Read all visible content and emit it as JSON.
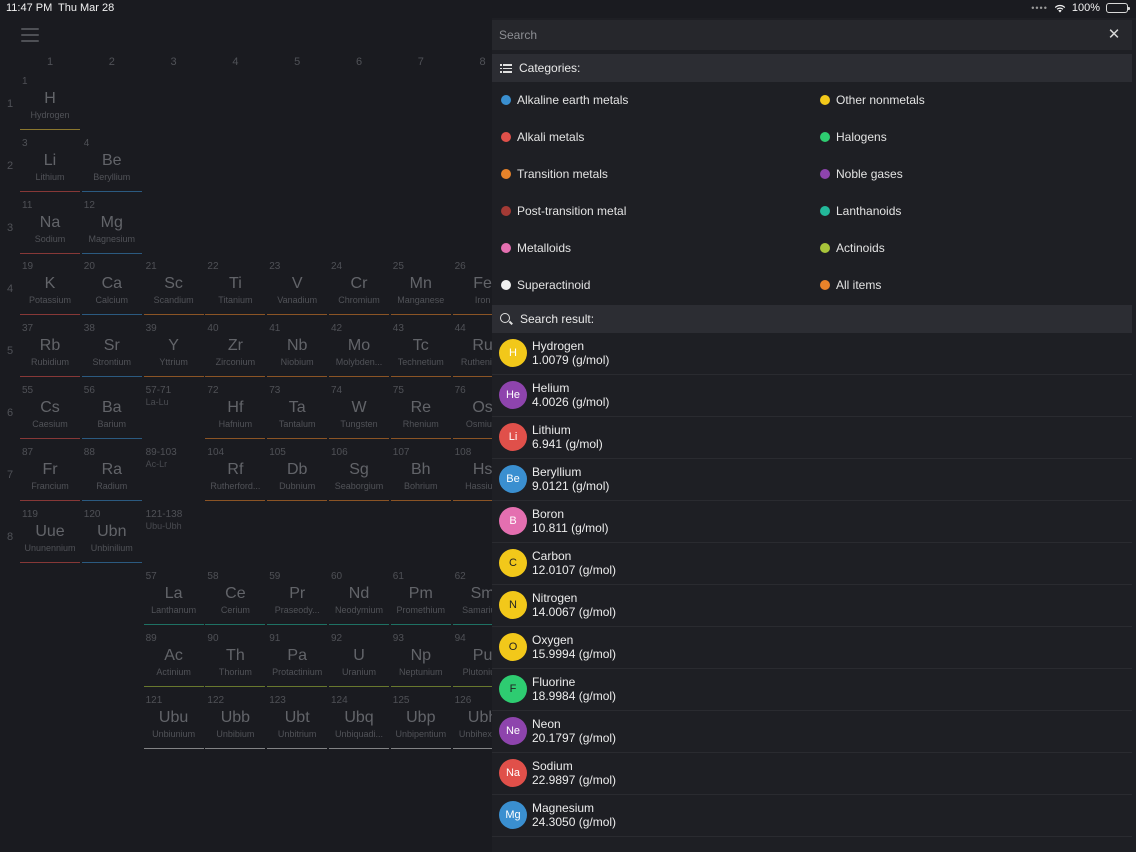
{
  "status_bar": {
    "time": "11:47 PM",
    "date": "Thu Mar 28",
    "battery": "100%",
    "battery_level": 1.0
  },
  "table": {
    "columns": [
      "1",
      "2",
      "3",
      "4",
      "5",
      "6",
      "7",
      "8"
    ],
    "rows": [
      "1",
      "2",
      "3",
      "4",
      "5",
      "6",
      "7",
      "8"
    ],
    "elements": [
      {
        "num": "1",
        "sym": "H",
        "name": "Hydrogen",
        "col": 0,
        "row": 0,
        "color": "#e8c33a"
      },
      {
        "num": "3",
        "sym": "Li",
        "name": "Lithium",
        "col": 0,
        "row": 1,
        "color": "#e0504a"
      },
      {
        "num": "4",
        "sym": "Be",
        "name": "Beryllium",
        "col": 1,
        "row": 1,
        "color": "#3a8fd0"
      },
      {
        "num": "11",
        "sym": "Na",
        "name": "Sodium",
        "col": 0,
        "row": 2,
        "color": "#e0504a"
      },
      {
        "num": "12",
        "sym": "Mg",
        "name": "Magnesium",
        "col": 1,
        "row": 2,
        "color": "#3a8fd0"
      },
      {
        "num": "19",
        "sym": "K",
        "name": "Potassium",
        "col": 0,
        "row": 3,
        "color": "#e0504a"
      },
      {
        "num": "20",
        "sym": "Ca",
        "name": "Calcium",
        "col": 1,
        "row": 3,
        "color": "#3a8fd0"
      },
      {
        "num": "21",
        "sym": "Sc",
        "name": "Scandium",
        "col": 2,
        "row": 3,
        "color": "#e8832a"
      },
      {
        "num": "22",
        "sym": "Ti",
        "name": "Titanium",
        "col": 3,
        "row": 3,
        "color": "#e8832a"
      },
      {
        "num": "23",
        "sym": "V",
        "name": "Vanadium",
        "col": 4,
        "row": 3,
        "color": "#e8832a"
      },
      {
        "num": "24",
        "sym": "Cr",
        "name": "Chromium",
        "col": 5,
        "row": 3,
        "color": "#e8832a"
      },
      {
        "num": "25",
        "sym": "Mn",
        "name": "Manganese",
        "col": 6,
        "row": 3,
        "color": "#e8832a"
      },
      {
        "num": "26",
        "sym": "Fe",
        "name": "Iron",
        "col": 7,
        "row": 3,
        "color": "#e8832a"
      },
      {
        "num": "37",
        "sym": "Rb",
        "name": "Rubidium",
        "col": 0,
        "row": 4,
        "color": "#e0504a"
      },
      {
        "num": "38",
        "sym": "Sr",
        "name": "Strontium",
        "col": 1,
        "row": 4,
        "color": "#3a8fd0"
      },
      {
        "num": "39",
        "sym": "Y",
        "name": "Yttrium",
        "col": 2,
        "row": 4,
        "color": "#e8832a"
      },
      {
        "num": "40",
        "sym": "Zr",
        "name": "Zirconium",
        "col": 3,
        "row": 4,
        "color": "#e8832a"
      },
      {
        "num": "41",
        "sym": "Nb",
        "name": "Niobium",
        "col": 4,
        "row": 4,
        "color": "#e8832a"
      },
      {
        "num": "42",
        "sym": "Mo",
        "name": "Molybden...",
        "col": 5,
        "row": 4,
        "color": "#e8832a"
      },
      {
        "num": "43",
        "sym": "Tc",
        "name": "Technetium",
        "col": 6,
        "row": 4,
        "color": "#e8832a"
      },
      {
        "num": "44",
        "sym": "Ru",
        "name": "Ruthenium",
        "col": 7,
        "row": 4,
        "color": "#e8832a"
      },
      {
        "num": "55",
        "sym": "Cs",
        "name": "Caesium",
        "col": 0,
        "row": 5,
        "color": "#e0504a"
      },
      {
        "num": "56",
        "sym": "Ba",
        "name": "Barium",
        "col": 1,
        "row": 5,
        "color": "#3a8fd0"
      },
      {
        "num": "72",
        "sym": "Hf",
        "name": "Hafnium",
        "col": 3,
        "row": 5,
        "color": "#e8832a"
      },
      {
        "num": "73",
        "sym": "Ta",
        "name": "Tantalum",
        "col": 4,
        "row": 5,
        "color": "#e8832a"
      },
      {
        "num": "74",
        "sym": "W",
        "name": "Tungsten",
        "col": 5,
        "row": 5,
        "color": "#e8832a"
      },
      {
        "num": "75",
        "sym": "Re",
        "name": "Rhenium",
        "col": 6,
        "row": 5,
        "color": "#e8832a"
      },
      {
        "num": "76",
        "sym": "Os",
        "name": "Osmium",
        "col": 7,
        "row": 5,
        "color": "#e8832a"
      },
      {
        "num": "87",
        "sym": "Fr",
        "name": "Francium",
        "col": 0,
        "row": 6,
        "color": "#e0504a"
      },
      {
        "num": "88",
        "sym": "Ra",
        "name": "Radium",
        "col": 1,
        "row": 6,
        "color": "#3a8fd0"
      },
      {
        "num": "104",
        "sym": "Rf",
        "name": "Rutherford...",
        "col": 3,
        "row": 6,
        "color": "#e8832a"
      },
      {
        "num": "105",
        "sym": "Db",
        "name": "Dubnium",
        "col": 4,
        "row": 6,
        "color": "#e8832a"
      },
      {
        "num": "106",
        "sym": "Sg",
        "name": "Seaborgium",
        "col": 5,
        "row": 6,
        "color": "#e8832a"
      },
      {
        "num": "107",
        "sym": "Bh",
        "name": "Bohrium",
        "col": 6,
        "row": 6,
        "color": "#e8832a"
      },
      {
        "num": "108",
        "sym": "Hs",
        "name": "Hassium",
        "col": 7,
        "row": 6,
        "color": "#e8832a"
      },
      {
        "num": "119",
        "sym": "Uue",
        "name": "Ununennium",
        "col": 0,
        "row": 7,
        "color": "#e0504a"
      },
      {
        "num": "120",
        "sym": "Ubn",
        "name": "Unbinilium",
        "col": 1,
        "row": 7,
        "color": "#3a8fd0"
      },
      {
        "num": "57",
        "sym": "La",
        "name": "Lanthanum",
        "col": 2,
        "row": 8,
        "color": "#23b89a"
      },
      {
        "num": "58",
        "sym": "Ce",
        "name": "Cerium",
        "col": 3,
        "row": 8,
        "color": "#23b89a"
      },
      {
        "num": "59",
        "sym": "Pr",
        "name": "Praseody...",
        "col": 4,
        "row": 8,
        "color": "#23b89a"
      },
      {
        "num": "60",
        "sym": "Nd",
        "name": "Neodymium",
        "col": 5,
        "row": 8,
        "color": "#23b89a"
      },
      {
        "num": "61",
        "sym": "Pm",
        "name": "Promethium",
        "col": 6,
        "row": 8,
        "color": "#23b89a"
      },
      {
        "num": "62",
        "sym": "Sm",
        "name": "Samarium",
        "col": 7,
        "row": 8,
        "color": "#23b89a"
      },
      {
        "num": "89",
        "sym": "Ac",
        "name": "Actinium",
        "col": 2,
        "row": 9,
        "color": "#a8c43a"
      },
      {
        "num": "90",
        "sym": "Th",
        "name": "Thorium",
        "col": 3,
        "row": 9,
        "color": "#a8c43a"
      },
      {
        "num": "91",
        "sym": "Pa",
        "name": "Protactinium",
        "col": 4,
        "row": 9,
        "color": "#a8c43a"
      },
      {
        "num": "92",
        "sym": "U",
        "name": "Uranium",
        "col": 5,
        "row": 9,
        "color": "#a8c43a"
      },
      {
        "num": "93",
        "sym": "Np",
        "name": "Neptunium",
        "col": 6,
        "row": 9,
        "color": "#a8c43a"
      },
      {
        "num": "94",
        "sym": "Pu",
        "name": "Plutonium",
        "col": 7,
        "row": 9,
        "color": "#a8c43a"
      },
      {
        "num": "121",
        "sym": "Ubu",
        "name": "Unbiunium",
        "col": 2,
        "row": 10,
        "color": "#d8d8d8"
      },
      {
        "num": "122",
        "sym": "Ubb",
        "name": "Unbibium",
        "col": 3,
        "row": 10,
        "color": "#d8d8d8"
      },
      {
        "num": "123",
        "sym": "Ubt",
        "name": "Unbitrium",
        "col": 4,
        "row": 10,
        "color": "#d8d8d8"
      },
      {
        "num": "124",
        "sym": "Ubq",
        "name": "Unbiquadi...",
        "col": 5,
        "row": 10,
        "color": "#d8d8d8"
      },
      {
        "num": "125",
        "sym": "Ubp",
        "name": "Unbipentium",
        "col": 6,
        "row": 10,
        "color": "#d8d8d8"
      },
      {
        "num": "126",
        "sym": "Ubh",
        "name": "Unbihexium",
        "col": 7,
        "row": 10,
        "color": "#d8d8d8"
      }
    ],
    "ranges": [
      {
        "num": "57-71",
        "label": "La-Lu",
        "col": 2,
        "row": 5
      },
      {
        "num": "89-103",
        "label": "Ac-Lr",
        "col": 2,
        "row": 6
      },
      {
        "num": "121-138",
        "label": "Ubu-Ubh",
        "col": 2,
        "row": 7
      }
    ]
  },
  "panel": {
    "search_placeholder": "Search",
    "categories_title": "Categories:",
    "results_title": "Search result:",
    "categories": [
      {
        "label": "Alkaline earth metals",
        "color": "#3a8fd0"
      },
      {
        "label": "Other nonmetals",
        "color": "#f2c81a"
      },
      {
        "label": "Alkali metals",
        "color": "#e0504a"
      },
      {
        "label": "Halogens",
        "color": "#2ecc71"
      },
      {
        "label": "Transition metals",
        "color": "#e8832a"
      },
      {
        "label": "Noble gases",
        "color": "#8e44ad"
      },
      {
        "label": "Post-transition metal",
        "color": "#a33a35"
      },
      {
        "label": "Lanthanoids",
        "color": "#23b89a"
      },
      {
        "label": "Metalloids",
        "color": "#e46fb0"
      },
      {
        "label": "Actinoids",
        "color": "#a8c43a"
      },
      {
        "label": "Superactinoid",
        "color": "#f0f0f0"
      },
      {
        "label": "All items",
        "color": "#e8832a"
      }
    ],
    "results": [
      {
        "sym": "H",
        "name": "Hydrogen",
        "mass": "1.0079 (g/mol)",
        "color": "#f2c81a",
        "dark": false
      },
      {
        "sym": "He",
        "name": "Helium",
        "mass": "4.0026 (g/mol)",
        "color": "#8e44ad",
        "dark": false
      },
      {
        "sym": "Li",
        "name": "Lithium",
        "mass": "6.941 (g/mol)",
        "color": "#e0504a",
        "dark": false
      },
      {
        "sym": "Be",
        "name": "Beryllium",
        "mass": "9.0121 (g/mol)",
        "color": "#3a8fd0",
        "dark": false
      },
      {
        "sym": "B",
        "name": "Boron",
        "mass": "10.811 (g/mol)",
        "color": "#e46fb0",
        "dark": false
      },
      {
        "sym": "C",
        "name": "Carbon",
        "mass": "12.0107 (g/mol)",
        "color": "#f2c81a",
        "dark": true
      },
      {
        "sym": "N",
        "name": "Nitrogen",
        "mass": "14.0067 (g/mol)",
        "color": "#f2c81a",
        "dark": true
      },
      {
        "sym": "O",
        "name": "Oxygen",
        "mass": "15.9994 (g/mol)",
        "color": "#f2c81a",
        "dark": true
      },
      {
        "sym": "F",
        "name": "Fluorine",
        "mass": "18.9984 (g/mol)",
        "color": "#2ecc71",
        "dark": true
      },
      {
        "sym": "Ne",
        "name": "Neon",
        "mass": "20.1797 (g/mol)",
        "color": "#8e44ad",
        "dark": false
      },
      {
        "sym": "Na",
        "name": "Sodium",
        "mass": "22.9897 (g/mol)",
        "color": "#e0504a",
        "dark": false
      },
      {
        "sym": "Mg",
        "name": "Magnesium",
        "mass": "24.3050 (g/mol)",
        "color": "#3a8fd0",
        "dark": false
      }
    ]
  }
}
